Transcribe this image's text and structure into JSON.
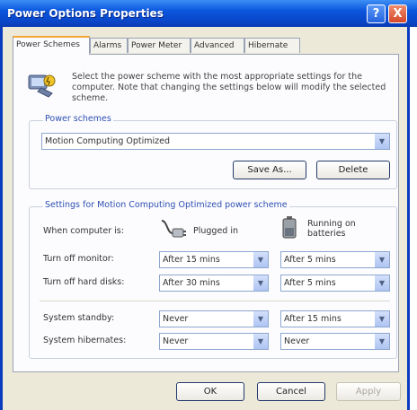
{
  "window": {
    "title": "Power Options Properties",
    "help_label": "?",
    "close_label": "X"
  },
  "tabs": [
    {
      "label": "Power Schemes",
      "active": true
    },
    {
      "label": "Alarms",
      "active": false
    },
    {
      "label": "Power Meter",
      "active": false
    },
    {
      "label": "Advanced",
      "active": false
    },
    {
      "label": "Hibernate",
      "active": false
    }
  ],
  "intro_text": "Select the power scheme with the most appropriate settings for the computer. Note that changing the settings below will modify the selected scheme.",
  "power_schemes": {
    "group_label": "Power schemes",
    "selected": "Motion Computing Optimized",
    "save_as_label": "Save As...",
    "delete_label": "Delete"
  },
  "settings": {
    "group_label": "Settings for Motion Computing Optimized power scheme",
    "when_label": "When computer is:",
    "plugged_in_label": "Plugged in",
    "batteries_label": "Running on batteries",
    "rows": [
      {
        "label": "Turn off monitor:",
        "plugged": "After 15 mins",
        "battery": "After 5 mins"
      },
      {
        "label": "Turn off hard disks:",
        "plugged": "After 30 mins",
        "battery": "After 5 mins"
      },
      {
        "label": "System standby:",
        "plugged": "Never",
        "battery": "After 15 mins"
      },
      {
        "label": "System hibernates:",
        "plugged": "Never",
        "battery": "Never"
      }
    ]
  },
  "footer": {
    "ok_label": "OK",
    "cancel_label": "Cancel",
    "apply_label": "Apply"
  },
  "colors": {
    "title_bar": "#0b56de",
    "tab_highlight": "#f3a536",
    "group_label": "#2d4fb2"
  }
}
